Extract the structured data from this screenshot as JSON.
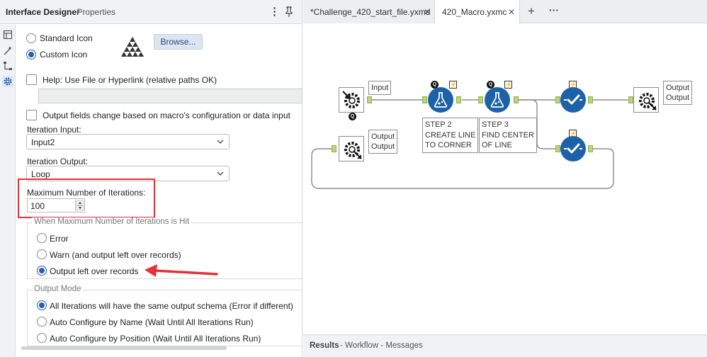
{
  "panel": {
    "title": "Interface Designer",
    "subtitle": "- Properties"
  },
  "icon_group": {
    "standard_label": "Standard Icon",
    "custom_label": "Custom Icon",
    "selected": "custom",
    "browse_label": "Browse..."
  },
  "help": {
    "label": "Help: Use File or Hyperlink (relative paths OK)",
    "value": ""
  },
  "output_fields_label": "Output fields change based on macro's configuration or data input",
  "iteration_input": {
    "label": "Iteration Input:",
    "value": "Input2"
  },
  "iteration_output": {
    "label": "Iteration Output:",
    "value": "Loop"
  },
  "max_iterations": {
    "label": "Maximum Number of Iterations:",
    "value": "100"
  },
  "when_max_hit": {
    "legend": "When Maximum Number of Iterations is Hit",
    "options": [
      "Error",
      "Warn (and output left over records)",
      "Output left over records"
    ],
    "selected_index": 2
  },
  "output_mode": {
    "legend": "Output Mode",
    "options": [
      "All Iterations will have the same output schema (Error if different)",
      "Auto Configure by Name (Wait Until All Iterations Run)",
      "Auto Configure by Position (Wait Until All Iterations Run)"
    ],
    "selected_index": 0
  },
  "tabs": [
    {
      "label": "*Challenge_420_start_file.yxmd",
      "close": "✕"
    },
    {
      "label": "420_Macro.yxmc",
      "close": "✕"
    }
  ],
  "tab_add": "+",
  "tab_more": "···",
  "workflow": {
    "input_annotation": "Input",
    "output1_annotation": [
      "Output",
      "Output"
    ],
    "output2_annotation": [
      "Output",
      "Output"
    ],
    "step2_annotation": [
      "STEP 2",
      "CREATE LINE",
      "TO CORNER"
    ],
    "step3_annotation": [
      "STEP 3",
      "FIND CENTER",
      "OF LINE"
    ]
  },
  "results": {
    "label": "Results",
    "rest": "- Workflow - Messages"
  },
  "colors": {
    "accent": "#2a5fa8",
    "highlight_box": "#e0333a",
    "arrow": "#e0333a",
    "tool_blue": "#1d62a8",
    "anchor_green": "#b5d67a"
  }
}
